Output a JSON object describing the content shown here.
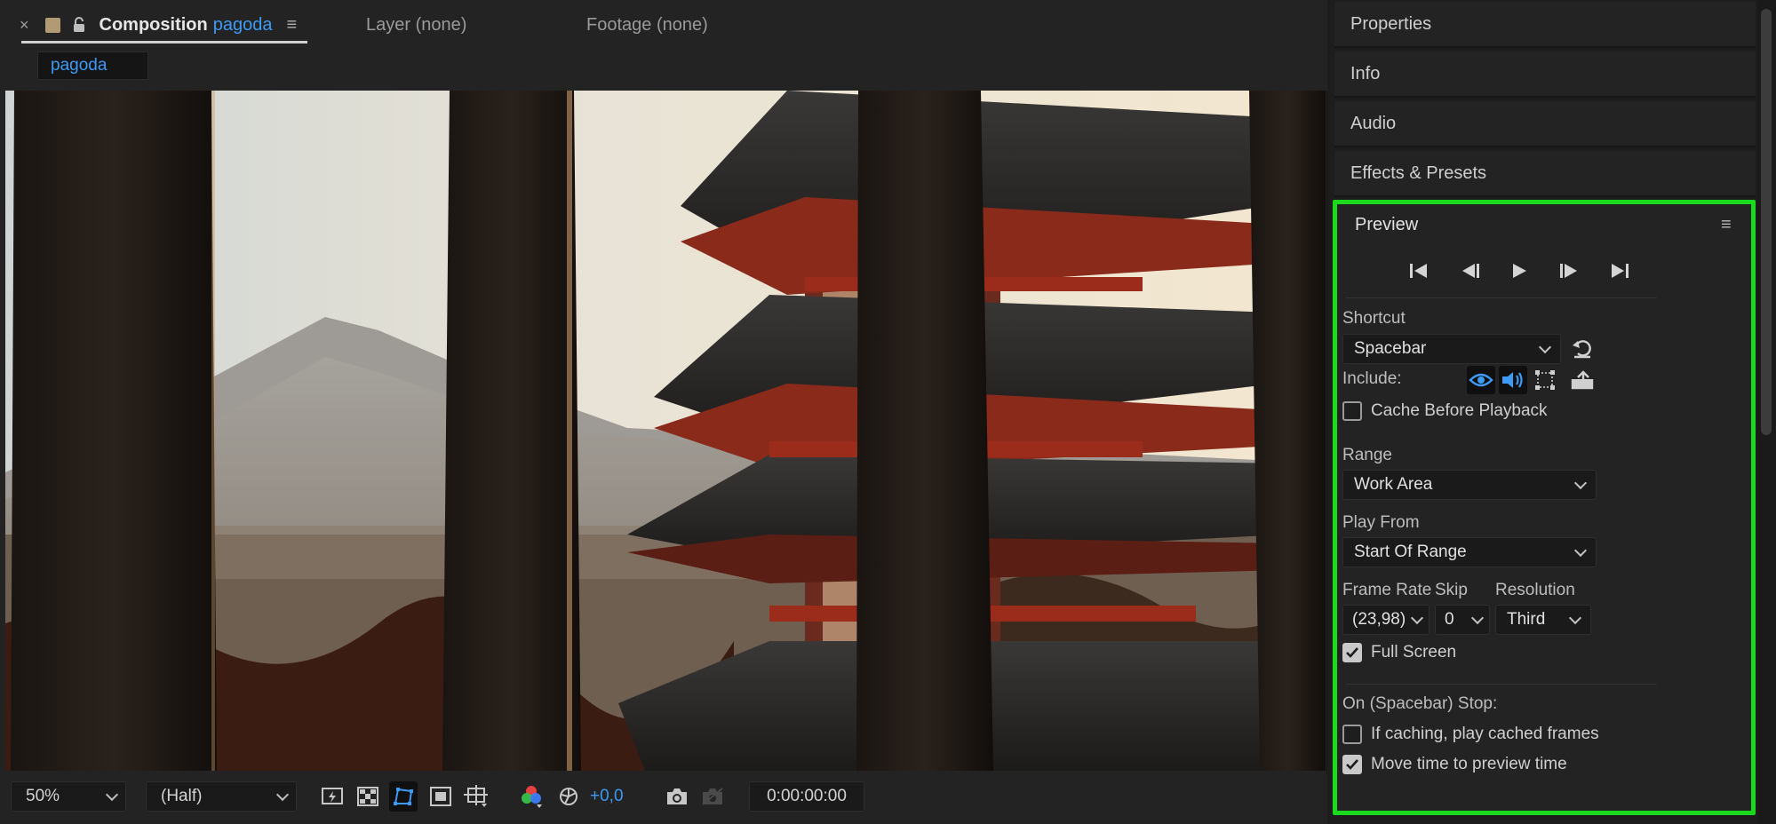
{
  "composition_tab": {
    "close_label": "×",
    "title_prefix": "Composition",
    "comp_name": "pagoda",
    "menu_glyph": "≡"
  },
  "other_tabs": {
    "layer": "Layer (none)",
    "footage": "Footage (none)"
  },
  "breadcrumb": "pagoda",
  "viewer": {
    "image_description_icon": "pagoda-photo"
  },
  "viewer_toolbar": {
    "zoom": "50%",
    "resolution": "(Half)",
    "exposure": "+0,0",
    "timecode": "0:00:00:00"
  },
  "right_panels": {
    "properties": "Properties",
    "info": "Info",
    "audio": "Audio",
    "effects_presets": "Effects & Presets"
  },
  "preview": {
    "title": "Preview",
    "menu_glyph": "≡",
    "shortcut_label": "Shortcut",
    "shortcut_value": "Spacebar",
    "include_label": "Include:",
    "cache_before_playback": "Cache Before Playback",
    "range_label": "Range",
    "range_value": "Work Area",
    "play_from_label": "Play From",
    "play_from_value": "Start Of Range",
    "frame_rate_label": "Frame Rate",
    "frame_rate_value": "(23,98)",
    "skip_label": "Skip",
    "skip_value": "0",
    "resolution_label": "Resolution",
    "resolution_value": "Third",
    "full_screen": "Full Screen",
    "on_stop_label": "On (Spacebar) Stop:",
    "if_caching": "If caching, play cached frames",
    "move_time": "Move time to preview time",
    "checks": {
      "cache_before_playback": false,
      "full_screen": true,
      "if_caching": false,
      "move_time": true
    }
  },
  "colors": {
    "accent_blue": "#3d9af5",
    "highlight_green": "#1bd91b",
    "panel_bg": "#232323"
  }
}
